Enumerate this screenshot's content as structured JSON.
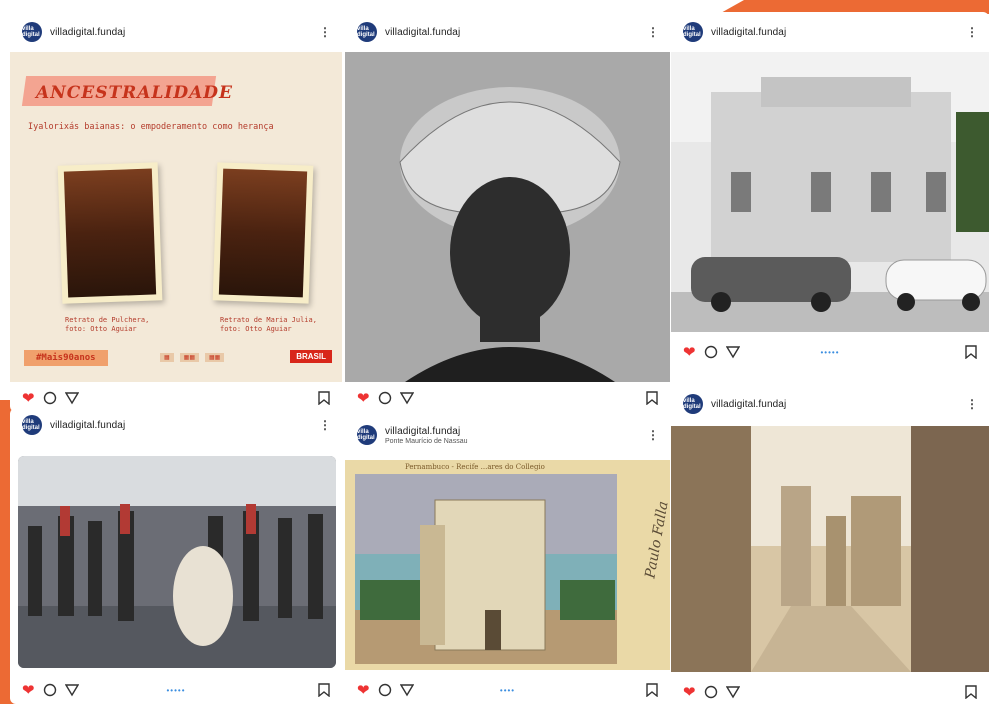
{
  "account": {
    "name": "villadigital.fundaj",
    "avatar_text": "villa digital"
  },
  "icons": {
    "heart": "heart-icon",
    "comment": "comment-icon",
    "share": "share-icon",
    "bookmark": "bookmark-icon",
    "more": "more-vertical-icon"
  },
  "colors": {
    "accent": "#ec6a34",
    "heart": "#e33333",
    "avatar": "#1f3b7a",
    "carousel_dots": "#3b8ee0"
  },
  "posts": [
    {
      "account": "villadigital.fundaj",
      "image": {
        "title": "ANCESTRALIDADE",
        "subtitle": "Iyalorixás baianas: o empoderamento como herança",
        "caption_left": "Retrato de Pulchera,\nfoto: Otto Aguiar",
        "caption_right": "Retrato de Maria Julia,\nfoto: Otto Aguiar",
        "hashtag": "#Mais90anos",
        "badge": "BRASIL"
      }
    },
    {
      "account": "villadigital.fundaj",
      "carousel": ""
    },
    {
      "account": "villadigital.fundaj",
      "carousel": "•••••"
    },
    {
      "account": "villadigital.fundaj",
      "carousel": "•••••"
    },
    {
      "account": "villadigital.fundaj",
      "location": "Ponte Maurício de Nassau",
      "image": {
        "postcard_header": "Pernambuco - Recife  ...ares do Collegio",
        "signature": "Paulo Falla"
      },
      "carousel": "••••"
    },
    {
      "account": "villadigital.fundaj",
      "carousel": ""
    }
  ]
}
